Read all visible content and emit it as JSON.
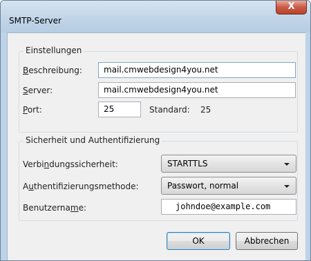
{
  "window": {
    "title": "SMTP-Server"
  },
  "titlebar": {
    "close_glyph": "X",
    "close_icon": "close-icon"
  },
  "settings": {
    "legend": "Einstellungen",
    "description": {
      "mnemonic": "B",
      "label_rest": "eschreibung:",
      "value": "mail.cmwebdesign4you.net"
    },
    "server": {
      "mnemonic": "S",
      "label_rest": "erver:",
      "value": "mail.cmwebdesign4you.net"
    },
    "port": {
      "mnemonic": "P",
      "label_rest": "ort:",
      "value": "25",
      "default_label": "Standard:",
      "default_value": "25"
    }
  },
  "security": {
    "legend": "Sicherheit und Authentifizierung",
    "connection_security": {
      "label_before": "Verbi",
      "mnemonic": "n",
      "label_after": "dungssicherheit:",
      "value": "STARTTLS"
    },
    "auth_method": {
      "label_before": "A",
      "mnemonic": "u",
      "label_after": "thentifizierungsmethode:",
      "value": "Passwort, normal"
    },
    "username": {
      "label_before": "Benutzerna",
      "mnemonic": "m",
      "label_after": "e:",
      "value": "johndoe@example.com"
    }
  },
  "buttons": {
    "ok": "OK",
    "cancel": "Abbrechen"
  }
}
